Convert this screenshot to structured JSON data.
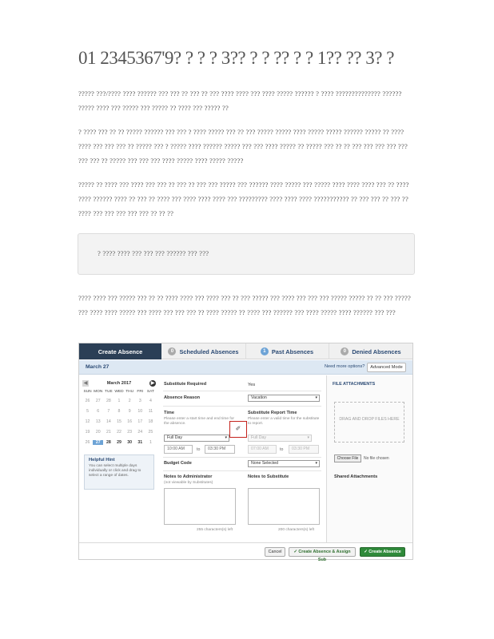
{
  "page": {
    "title": "01  2345367'9? ? ? ? 3?? ? ? ?? ? ? 1?? ?? 3?  ?",
    "paragraphs": [
      "????? ???/???? ????  ?????? ??? ??? ?? ??? ?? ??? ???? ???? ??? ???? ????? ?????? ? ???? ?????????????? ?????? ?????  ???? ??? ????? ??? ????? ?? ???? ??? ????? ??",
      "? ???? ??? ?? ?? ????? ?????? ??? ??? ?  ???? ????? ??? ?? ??? ????? ????? ???? ????? ????? ?????? ????? ?? ???? ???? ??? ??? ??? ?? ????? ??? ? ?????  ???? ?????? ????? ??? ??? ???? ????? ?? ????? ??? ?? ??  ??? ??? ??? ??? ??? ??? ??? ??  ????? ??? ??? ??? ???? ????? ???? ????? ?????",
      "????? ??  ???? ??? ???? ??? ??? ?? ??? ?? ??? ??? ????? ??? ?????? ???? ????? ??? ????? ???? ???? ???? ??? ?? ???? ???? ?????? ???? ?? ??? ?? ???? ??? ???? ???? ???? ??? ?????????  ???? ???? ????  ??????????? ?? ??? ??? ?? ???  ??  ???? ??? ??? ??? ??? ??? ?? ?? ??",
      "???? ???? ??? ????? ??? ?? ??  ???? ???? ??? ???? ??? ?? ??? ????? ??? ???? ??? ??? ??? ????? ????? ?? ?? ???  ?????  ??? ???? ???? ????? ??? ???? ??? ??? ??? ?? ???? ????? ?? ???? ??? ?????? ??? ???? ????? ???? ?????? ??? ???"
    ],
    "callout": "? ???? ???? ??? ??? ??? ?????? ??? ???"
  },
  "app": {
    "tabs": [
      {
        "label": "Create Absence",
        "count": ""
      },
      {
        "label": "Scheduled Absences",
        "count": "0"
      },
      {
        "label": "Past Absences",
        "count": "1"
      },
      {
        "label": "Denied Absences",
        "count": "0"
      }
    ],
    "date_header": "March 27",
    "need_more": "Need more options?",
    "advanced_button": "Advanced Mode",
    "calendar": {
      "month": "March 2017",
      "prev": "◀",
      "next": "▶",
      "dow": [
        "SUN",
        "MON",
        "TUE",
        "WED",
        "THU",
        "FRI",
        "SAT"
      ],
      "days": [
        "26",
        "27",
        "28",
        "1",
        "2",
        "3",
        "4",
        "5",
        "6",
        "7",
        "8",
        "9",
        "10",
        "11",
        "12",
        "13",
        "14",
        "15",
        "16",
        "17",
        "18",
        "19",
        "20",
        "21",
        "22",
        "23",
        "24",
        "25",
        "26",
        "27",
        "28",
        "29",
        "30",
        "31",
        "1"
      ],
      "selected": "27"
    },
    "hint": {
      "title": "Helpful Hint",
      "text": "You can select multiple days individually or click and drag to select a range of dates."
    },
    "form": {
      "substitute_required_label": "Substitute Required",
      "substitute_required_value": "Yes",
      "absence_reason_label": "Absence Reason",
      "absence_reason_value": "Vacation",
      "time_label": "Time",
      "time_help": "Please enter a start time and end time for the absence.",
      "time_value": "Full Day",
      "start_time": "10:00 AM",
      "to1": "to",
      "end_time": "03:30 PM",
      "sub_time_label": "Substitute Report Time",
      "sub_time_help": "Please enter a valid time for the substitute to report.",
      "sub_time_value": "Full Day",
      "sub_start": "07:00 AM",
      "to2": "to",
      "sub_end": "03:30 PM",
      "copy_icon": "✐",
      "budget_code_label": "Budget Code",
      "budget_code_value": "None Selected",
      "notes_admin_label": "Notes to Administrator",
      "notes_admin_sub": "(not viewable by Substitutes)",
      "notes_sub_label": "Notes to Substitute",
      "chars_admin": "255 characters(s) left",
      "chars_sub": "200 characters(s) left"
    },
    "attachments": {
      "title": "FILE ATTACHMENTS",
      "drop_text": "DRAG AND DROP FILES HERE",
      "choose_file": "Choose File",
      "no_file": "No file chosen",
      "shared": "Shared Attachments"
    },
    "footer": {
      "cancel": "Cancel",
      "create_assign": "✓ Create Absence & Assign Sub",
      "create": "✓ Create Absence"
    }
  }
}
